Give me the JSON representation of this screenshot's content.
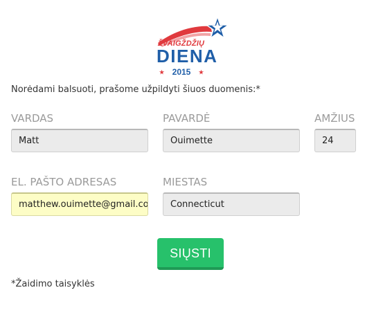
{
  "logo": {
    "top_text": "ŽVAIGŽDŽIŲ",
    "main_text": "DIENA",
    "year": "2015",
    "star_glyph": "★",
    "colors": {
      "red": "#e03a3e",
      "blue": "#1f5ea8"
    }
  },
  "intro": "Norėdami balsuoti, prašome užpildyti šiuos duomenis:*",
  "fields": {
    "name": {
      "label": "VARDAS",
      "value": "Matt"
    },
    "surname": {
      "label": "PAVARDĖ",
      "value": "Ouimette"
    },
    "age": {
      "label": "AMŽIUS",
      "value": "24"
    },
    "email": {
      "label": "EL. PAŠTO ADRESAS",
      "value": "matthew.ouimette@gmail.com"
    },
    "city": {
      "label": "MIESTAS",
      "value": "Connecticut"
    }
  },
  "submit_label": "SIŲSTI",
  "rules_link": "*Žaidimo taisyklės",
  "colors": {
    "submit": "#27c16b",
    "label": "#9a9a9a",
    "input_bg": "#ebebeb",
    "autofill_bg": "#fdfdc6"
  }
}
